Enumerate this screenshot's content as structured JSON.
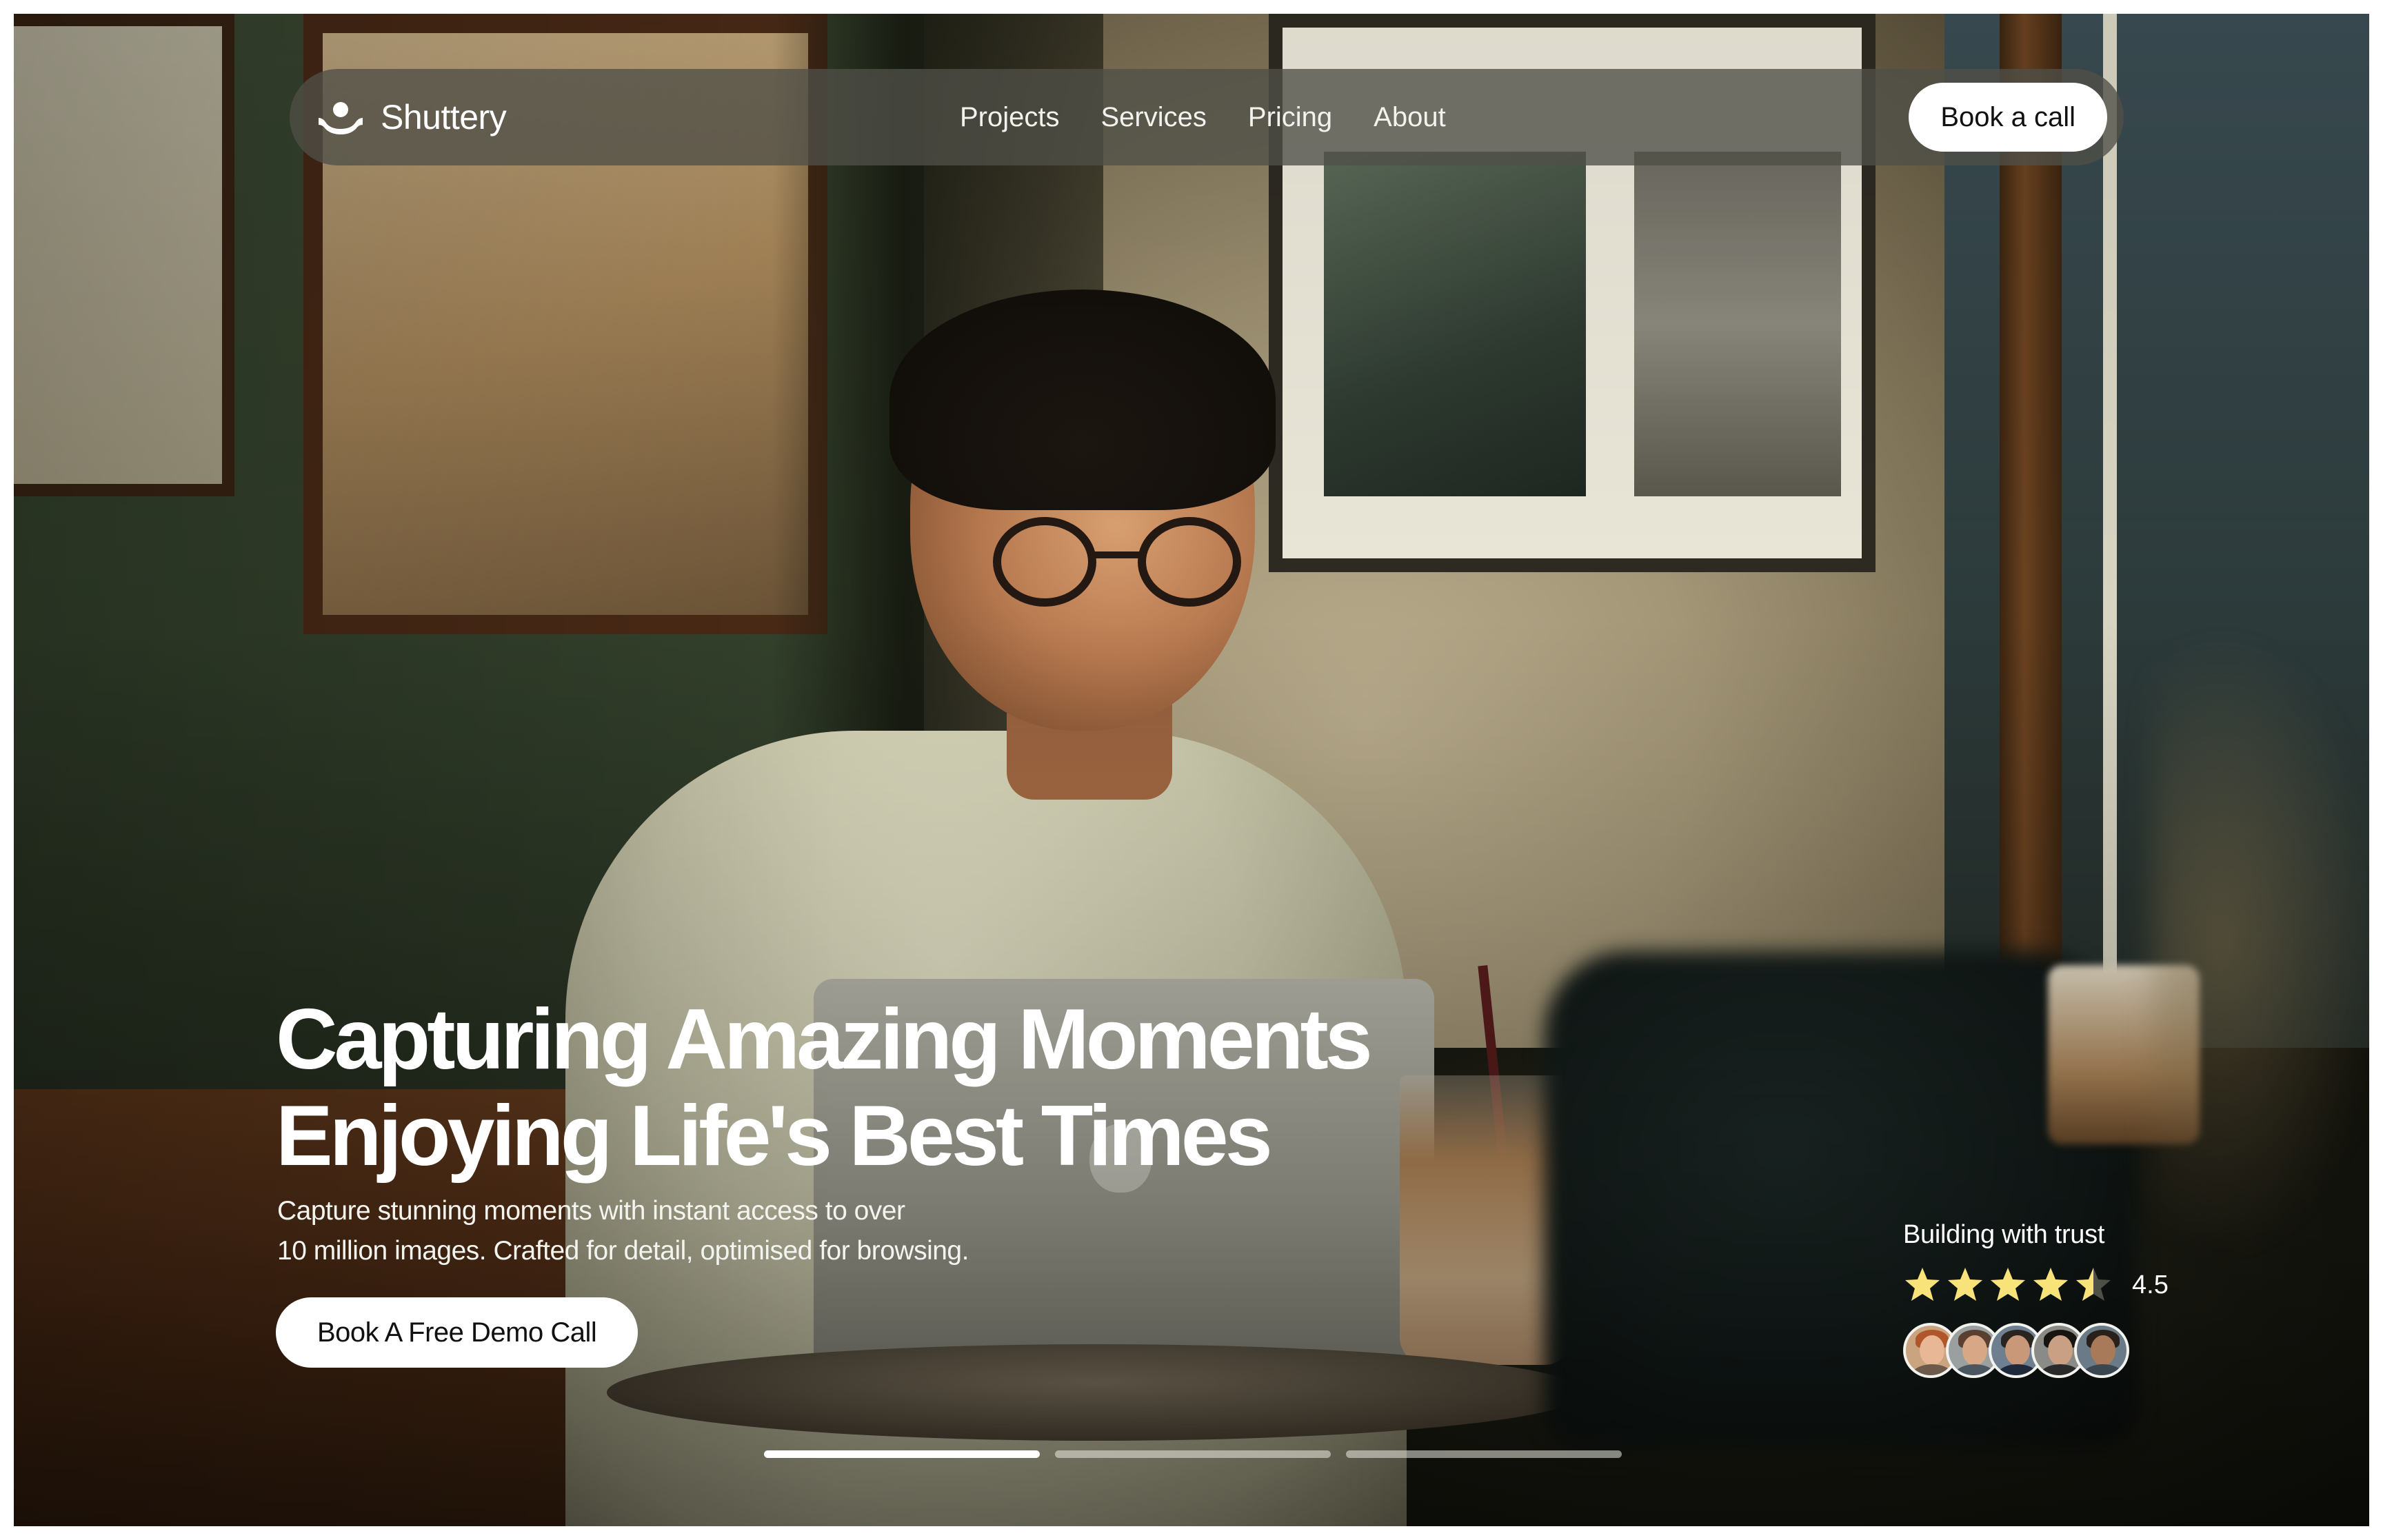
{
  "brand": {
    "name": "Shuttery"
  },
  "nav": {
    "links": [
      "Projects",
      "Services",
      "Pricing",
      "About"
    ],
    "cta_label": "Book a call"
  },
  "hero": {
    "title_line1": "Capturing Amazing Moments",
    "title_line2": "Enjoying Life's Best Times",
    "subtitle_line1": "Capture stunning moments with instant access to over",
    "subtitle_line2": "10 million images. Crafted for detail, optimised for browsing.",
    "cta_label": "Book A Free Demo Call"
  },
  "trust": {
    "label": "Building with trust",
    "rating": "4.5",
    "rating_value": 4.5,
    "rating_max": 5,
    "star_color": "#f7e37a",
    "avatar_count": 5
  },
  "carousel": {
    "slides": 3,
    "active_index": 0
  },
  "colors": {
    "nav_background": "#50504a",
    "button_background": "#ffffff",
    "button_text": "#111111",
    "text_on_image": "#ffffff"
  },
  "icons": {
    "logo": "shutter-wave-logo-icon",
    "rating": "star-icon"
  }
}
